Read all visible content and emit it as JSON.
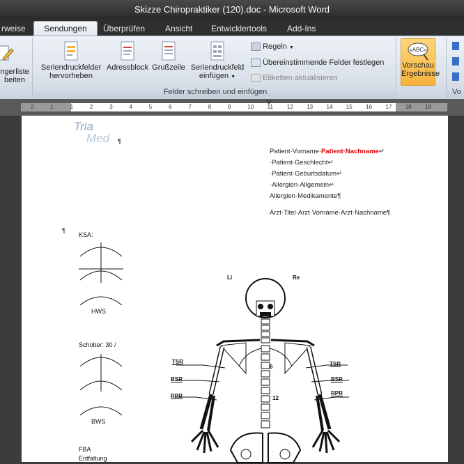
{
  "window": {
    "title": "Skizze Chiropraktiker (120).doc - Microsoft Word"
  },
  "tabs": [
    "rweise",
    "Sendungen",
    "Überprüfen",
    "Ansicht",
    "Entwicklertools",
    "Add-Ins"
  ],
  "ribbon": {
    "left_partial": {
      "line1": "ngerliste",
      "line2": "beiten"
    },
    "group_label": "Felder schreiben und einfügen",
    "buttons": {
      "highlight": {
        "line1": "Seriendruckfelder",
        "line2": "hervorheben"
      },
      "address": "Adressblock",
      "greeting": "Grußzeile",
      "insert_field": {
        "line1": "Seriendruckfeld",
        "line2": "einfügen"
      }
    },
    "rules": "Regeln",
    "match_fields": "Übereinstimmende Felder festlegen",
    "update_labels": "Etiketten aktualisieren",
    "preview": {
      "line1": "Vorschau",
      "line2": "Ergebnisse"
    },
    "right_partial": "Vo"
  },
  "ruler": {
    "labels": [
      "2",
      "1",
      "1",
      "2",
      "3",
      "4",
      "5",
      "6",
      "7",
      "8",
      "9",
      "10",
      "11",
      "12",
      "13",
      "14",
      "15",
      "16",
      "17",
      "18",
      "19"
    ]
  },
  "document": {
    "logo": {
      "line1": "Tria",
      "line2": "Med"
    },
    "address_lines": [
      {
        "prefix": "Patient·Vorname·",
        "red": "Patient·Nachname",
        "suffix": "↵"
      },
      {
        "text": "·Patient·Geschlecht↵"
      },
      {
        "text": "·Patient·Geburtsdatum↵"
      },
      {
        "text": "·Allergien·Allgemein↵"
      },
      {
        "text": "Allergien·Medikamente¶"
      }
    ],
    "doctor_line": "Arzt·Titel·Arzt·Vorname·Arzt·Nachname¶",
    "pilcrow": "¶",
    "ksa": "KSA:",
    "hws": "HWS",
    "schober": "Schober: 30 /",
    "bws": "BWS",
    "fba": "FBA",
    "entfaltung": "Entfaltung",
    "li": "Li",
    "re": "Re",
    "tsr": "TSR",
    "bsr": "BSR",
    "rpr": "RPR",
    "num6": "6",
    "num12": "12"
  },
  "colors": {
    "accent": "#f7b23b",
    "red": "#dd0000",
    "logo": "#8fa9c8"
  }
}
